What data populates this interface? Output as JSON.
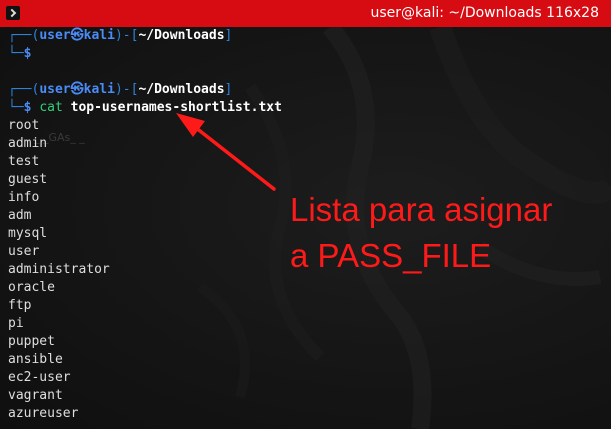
{
  "window": {
    "title": "user@kali: ~/Downloads 116x28"
  },
  "prompt1": {
    "user": "user",
    "at_symbol": "㉿",
    "host": "kali",
    "path": "~/Downloads",
    "dollar": "$"
  },
  "prompt2": {
    "user": "user",
    "at_symbol": "㉿",
    "host": "kali",
    "path": "~/Downloads",
    "dollar": "$",
    "command": "cat",
    "argument": "top-usernames-shortlist.txt"
  },
  "output": [
    "root",
    "admin",
    "test",
    "guest",
    "info",
    "adm",
    "mysql",
    "user",
    "administrator",
    "oracle",
    "ftp",
    "pi",
    "puppet",
    "ansible",
    "ec2-user",
    "vagrant",
    "azureuser"
  ],
  "annotation": {
    "line1": "Lista para asignar",
    "line2": "a PASS_FILE",
    "color": "#ff1a1a"
  },
  "colors": {
    "titlebar": "#d70c12",
    "prompt_user": "#4a8cf7",
    "command": "#2fd07a",
    "box_lines": "#2f82d8"
  }
}
